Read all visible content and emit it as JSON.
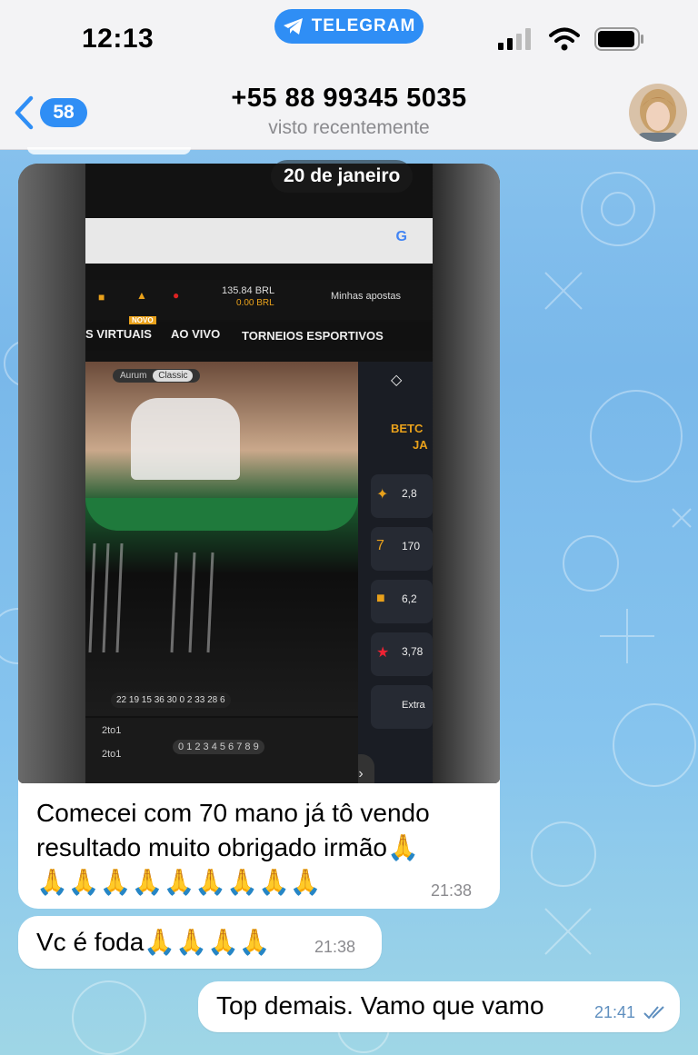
{
  "status_bar": {
    "time": "12:13",
    "app_pill": "TELEGRAM"
  },
  "header": {
    "back_count": "58",
    "contact_name": "+55 88 99345 5035",
    "contact_status": "visto recentemente"
  },
  "media_message": {
    "date_label": "20 de janeiro",
    "caption_line1": "Comecei com 70 mano já tô vendo",
    "caption_line2": "resultado muito obrigado irmão🙏",
    "caption_line3": "🙏🙏🙏🙏🙏🙏🙏🙏🙏",
    "time": "21:38",
    "screen": {
      "balance": "135.84 BRL",
      "bonus": "0.00 BRL",
      "my_bets": "Minhas apostas",
      "nav_virtuais": "S VIRTUAIS",
      "nav_ao_vivo": "AO VIVO",
      "nav_torneios": "TORNEIOS ESPORTIVOS",
      "novo_tag": "NOVO",
      "mode_aurum": "Aurum",
      "mode_classic": "Classic",
      "brand_fragment": "BETC",
      "brand_fragment2": "JA",
      "val1": "2,8",
      "val2": "170",
      "val3": "6,2",
      "val4": "3,78",
      "extra": "Extra",
      "results": "22 19 15 36 30 0 2 33 28 6",
      "row_2to1_a": "2to1",
      "row_2to1_b": "2to1",
      "digits": "0 1 2 3 4 5 6 7 8 9"
    }
  },
  "message2": {
    "text": "Vc é foda🙏🙏🙏🙏",
    "time": "21:38"
  },
  "message3": {
    "text": "Top demais. Vamo que vamo",
    "time": "21:41"
  },
  "colors": {
    "accent": "#2f8ef5",
    "header_bg": "#f3f3f5"
  }
}
